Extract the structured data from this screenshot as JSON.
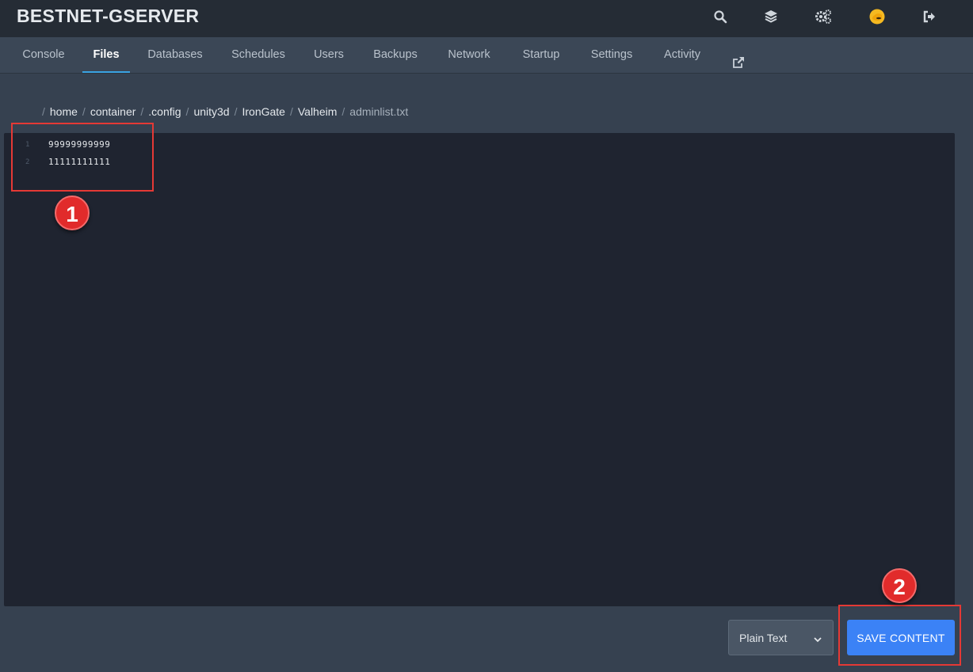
{
  "app": {
    "title": "BESTNET-GSERVER"
  },
  "top_icons": [
    "search-icon",
    "layers-icon",
    "cogs-icon",
    "avatar-icon",
    "logout-icon"
  ],
  "tabs": [
    {
      "label": "Console"
    },
    {
      "label": "Files",
      "active": true
    },
    {
      "label": "Databases"
    },
    {
      "label": "Schedules"
    },
    {
      "label": "Users"
    },
    {
      "label": "Backups"
    },
    {
      "label": "Network"
    },
    {
      "label": "Startup"
    },
    {
      "label": "Settings"
    },
    {
      "label": "Activity"
    },
    {
      "label": "",
      "icon": "external-link-icon"
    }
  ],
  "breadcrumb": {
    "separator": "/",
    "segments": [
      "home",
      "container",
      ".config",
      "unity3d",
      "IronGate",
      "Valheim"
    ],
    "current": "adminlist.txt"
  },
  "editor": {
    "lines": [
      {
        "number": "1",
        "text": "99999999999"
      },
      {
        "number": "2",
        "text": "11111111111"
      }
    ]
  },
  "annotations": {
    "badge1": "1",
    "badge2": "2"
  },
  "footer": {
    "mode_select": "Plain Text",
    "save_label": "SAVE CONTENT"
  },
  "colors": {
    "accent": "#3b82f6",
    "tab_underline": "#3aa3e3",
    "annotation": "#e53935",
    "background": "#364150",
    "topbar": "#252c35",
    "editor": "#1f2430"
  }
}
